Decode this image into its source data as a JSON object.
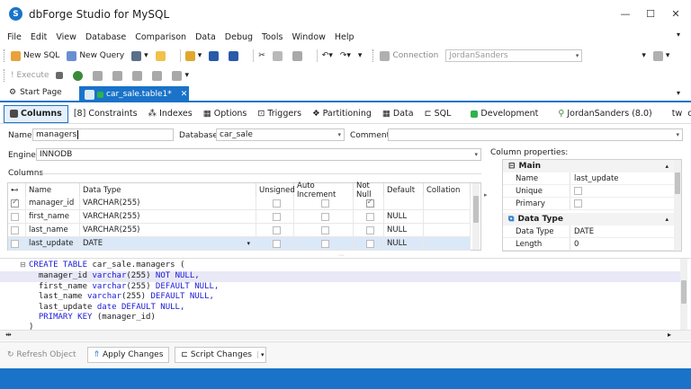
{
  "window": {
    "title": "dbForge Studio for MySQL",
    "logo_letter": "S"
  },
  "menu": [
    "File",
    "Edit",
    "View",
    "Database",
    "Comparison",
    "Data",
    "Debug",
    "Tools",
    "Window",
    "Help"
  ],
  "toolbar": {
    "new_sql": "New SQL",
    "new_query": "New Query",
    "connection_label": "Connection",
    "connection_value": "JordanSanders",
    "execute": "Execute"
  },
  "doc_tabs": {
    "start_page": "Start Page",
    "active": "car_sale.table1*"
  },
  "designer_tabs": [
    "Columns",
    "Constraints",
    "Indexes",
    "Options",
    "Triggers",
    "Partitioning",
    "Data",
    "SQL"
  ],
  "status_info": {
    "environment": "Development",
    "user": "JordanSanders (8.0)",
    "tw": "tw",
    "database": "car_sale"
  },
  "form": {
    "name_label": "Name:",
    "name_value": "managers",
    "database_label": "Database:",
    "database_value": "car_sale",
    "comment_label": "Comment:",
    "comment_value": "",
    "engine_label": "Engine:",
    "engine_value": "INNODB",
    "columns_label": "Columns",
    "column_properties_label": "Column properties:"
  },
  "grid": {
    "headers": [
      "Name",
      "Data Type",
      "Unsigned",
      "Auto Increment",
      "Not Null",
      "Default",
      "Collation"
    ],
    "rows": [
      {
        "name": "manager_id",
        "type": "VARCHAR(255)",
        "default": "",
        "pk": true,
        "not_null": true
      },
      {
        "name": "first_name",
        "type": "VARCHAR(255)",
        "default": "NULL",
        "pk": false,
        "not_null": false
      },
      {
        "name": "last_name",
        "type": "VARCHAR(255)",
        "default": "NULL",
        "pk": false,
        "not_null": false
      },
      {
        "name": "last_update",
        "type": "DATE",
        "default": "NULL",
        "pk": false,
        "not_null": false
      }
    ]
  },
  "properties": {
    "main_label": "Main",
    "main": [
      {
        "name": "Name",
        "value": "last_update"
      },
      {
        "name": "Unique",
        "value": ""
      },
      {
        "name": "Primary",
        "value": ""
      }
    ],
    "datatype_label": "Data Type",
    "datatype": [
      {
        "name": "Data Type",
        "value": "DATE"
      },
      {
        "name": "Length",
        "value": "0"
      }
    ]
  },
  "sql": {
    "l1a": "CREATE TABLE ",
    "l1b": "car_sale.managers (",
    "l2a": "  manager_id ",
    "l2b": "varchar",
    "l2c": "(255) ",
    "l2d": "NOT NULL,",
    "l3a": "  first_name ",
    "l3b": "varchar",
    "l3c": "(255) ",
    "l3d": "DEFAULT NULL,",
    "l4a": "  last_name ",
    "l4b": "varchar",
    "l4c": "(255) ",
    "l4d": "DEFAULT NULL,",
    "l5a": "  last_update ",
    "l5b": "date ",
    "l5d": "DEFAULT NULL,",
    "l6a": "  PRIMARY KEY ",
    "l6b": "(manager_id)",
    "l7": ")"
  },
  "bottom": {
    "refresh": "Refresh Object",
    "apply": "Apply Changes",
    "script": "Script Changes"
  },
  "colors": {
    "accent": "#1a73c9",
    "keyword": "#1a1ad6",
    "environment": "#2db34a"
  }
}
